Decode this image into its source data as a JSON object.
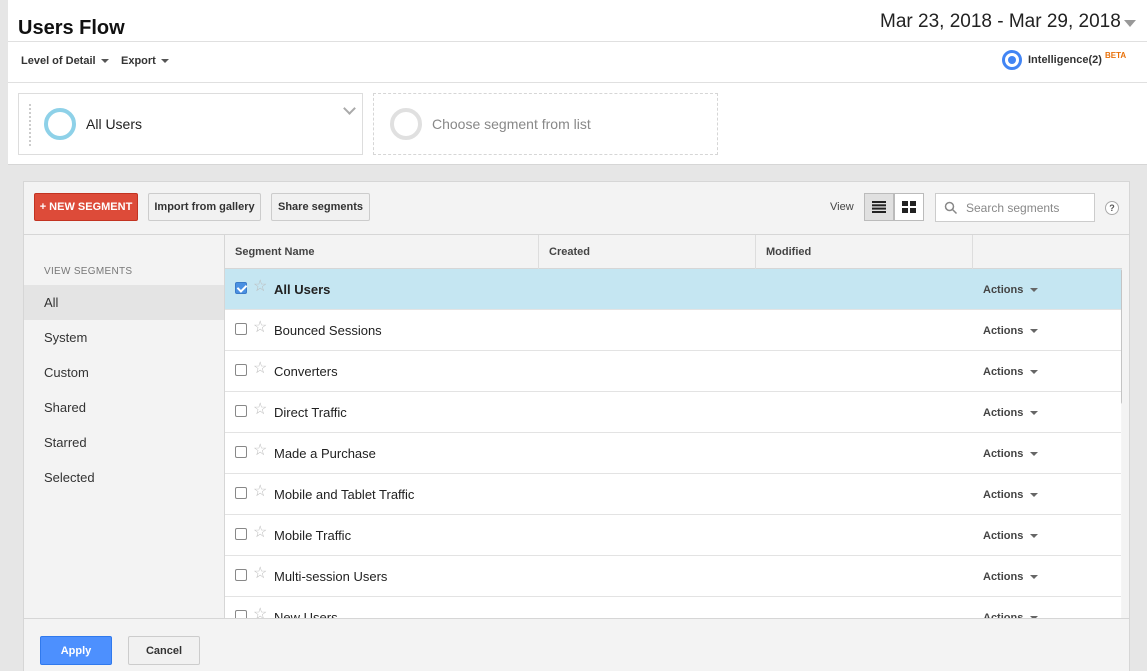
{
  "header": {
    "title": "Users Flow",
    "date_range": "Mar 23, 2018 - Mar 29, 2018",
    "level_of_detail": "Level of Detail",
    "export": "Export",
    "intelligence": "Intelligence(2)",
    "beta": "BETA"
  },
  "segments_bar": {
    "active_segment": "All Users",
    "empty_placeholder": "Choose segment from list"
  },
  "panel": {
    "new_segment": "+ NEW SEGMENT",
    "import_gallery": "Import from gallery",
    "share_segments": "Share segments",
    "view_label": "View",
    "search_placeholder": "Search segments",
    "help": "?"
  },
  "sidebar": {
    "heading": "VIEW SEGMENTS",
    "items": [
      "All",
      "System",
      "Custom",
      "Shared",
      "Starred",
      "Selected"
    ]
  },
  "table": {
    "columns": [
      "Segment Name",
      "Created",
      "Modified"
    ],
    "actions_label": "Actions",
    "rows": [
      {
        "name": "All Users",
        "checked": true
      },
      {
        "name": "Bounced Sessions",
        "checked": false
      },
      {
        "name": "Converters",
        "checked": false
      },
      {
        "name": "Direct Traffic",
        "checked": false
      },
      {
        "name": "Made a Purchase",
        "checked": false
      },
      {
        "name": "Mobile and Tablet Traffic",
        "checked": false
      },
      {
        "name": "Mobile Traffic",
        "checked": false
      },
      {
        "name": "Multi-session Users",
        "checked": false
      },
      {
        "name": "New Users",
        "checked": false
      }
    ]
  },
  "footer": {
    "apply": "Apply",
    "cancel": "Cancel"
  }
}
